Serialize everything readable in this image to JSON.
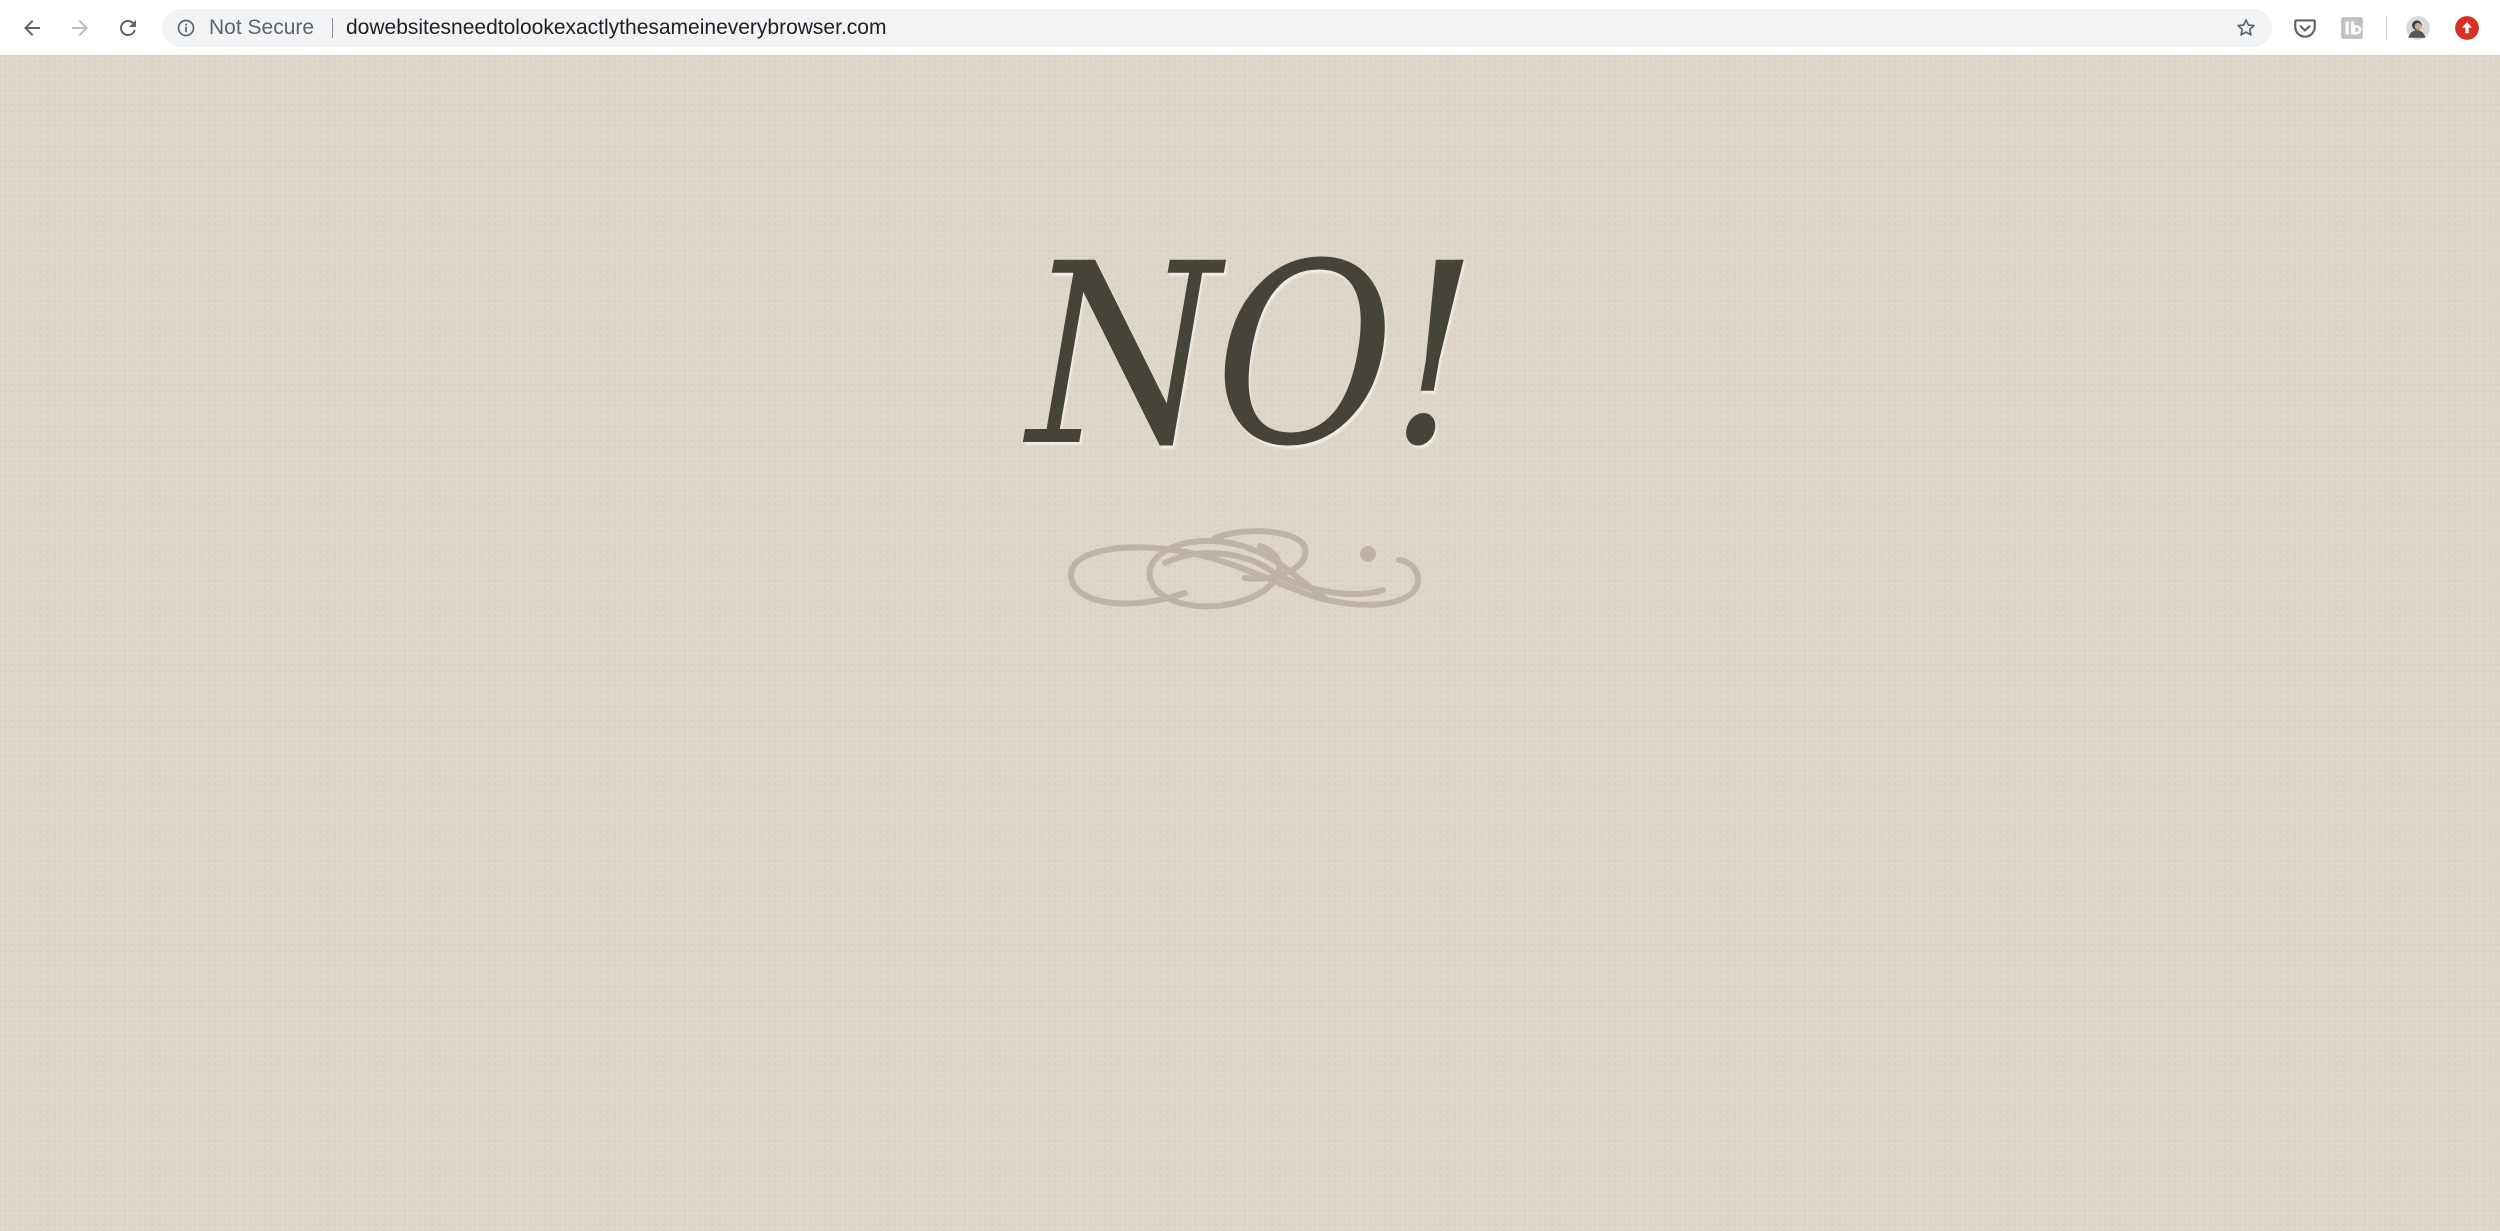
{
  "browser": {
    "back_label": "Back",
    "forward_label": "Forward",
    "reload_label": "Reload",
    "security_label": "Not Secure",
    "url": "dowebsitesneedtolookexactlythesameineverybrowser.com",
    "bookmark_icon": "star-icon",
    "extensions": [
      {
        "icon": "pocket-icon"
      },
      {
        "icon": "lb-extension-icon",
        "text": "lb"
      },
      {
        "icon": "profile-avatar"
      },
      {
        "icon": "red-extension-icon"
      }
    ]
  },
  "page": {
    "headline": "NO!",
    "ornament_icon": "flourish-ornament",
    "colors": {
      "background": "#ddd5c8",
      "headline": "#46433b",
      "ornament": "#bdb4a7"
    }
  }
}
